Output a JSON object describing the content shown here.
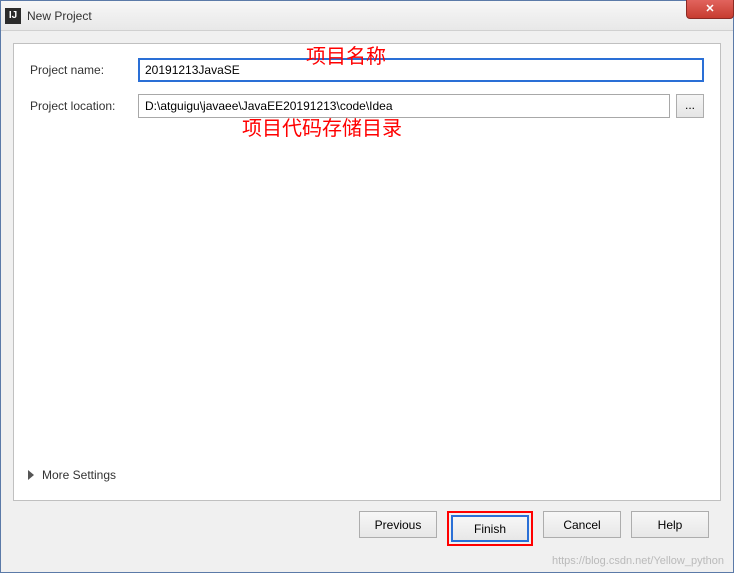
{
  "window": {
    "title": "New Project"
  },
  "form": {
    "name_label": "Project name:",
    "name_value": "20191213JavaSE",
    "location_label": "Project location:",
    "location_value": "D:\\atguigu\\javaee\\JavaEE20191213\\code\\Idea",
    "browse_label": "..."
  },
  "annotations": {
    "name": "项目名称",
    "location": "项目代码存储目录"
  },
  "more_settings": "More Settings",
  "buttons": {
    "previous": "Previous",
    "finish": "Finish",
    "cancel": "Cancel",
    "help": "Help"
  },
  "watermark": "https://blog.csdn.net/Yellow_python"
}
